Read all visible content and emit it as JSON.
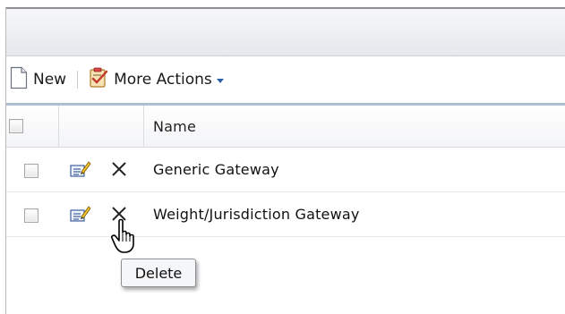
{
  "toolbar": {
    "new_label": "New",
    "more_actions_label": "More Actions",
    "new_icon": "new-document-icon",
    "more_actions_icon": "clipboard-check-icon"
  },
  "grid": {
    "columns": [
      "",
      "",
      "Name"
    ],
    "rows": [
      {
        "name": "Generic Gateway",
        "checked": false
      },
      {
        "name": "Weight/Jurisdiction Gateway",
        "checked": false
      }
    ]
  },
  "tooltip": {
    "text": "Delete"
  },
  "colors": {
    "accent": "#2b5fa8",
    "header_border": "#aebfd2"
  }
}
